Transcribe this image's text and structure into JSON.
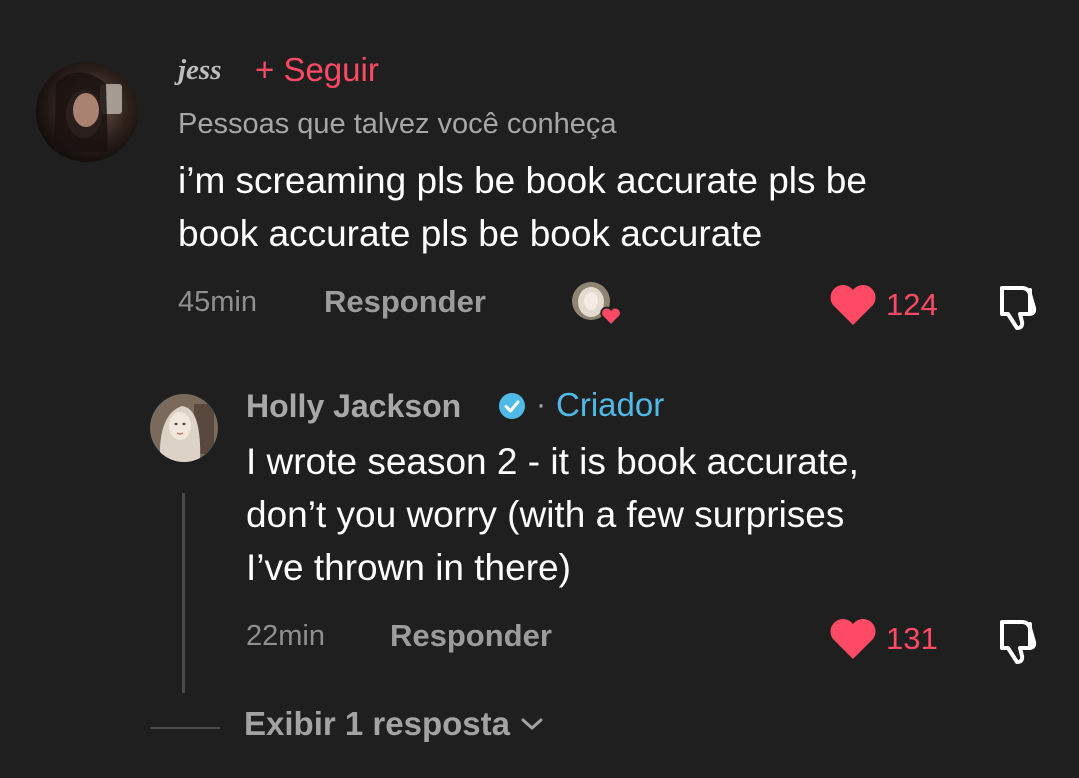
{
  "comments": [
    {
      "username": "jess",
      "follow_label": "+ Seguir",
      "subtext": "Pessoas que talvez você conheça",
      "text": "i’m screaming pls be book accurate pls be\nbook accurate pls be book accurate",
      "time": "45min",
      "reply_label": "Responder",
      "likes": "124"
    }
  ],
  "reply": {
    "author": "Holly Jackson",
    "separator": "·",
    "badge": "Criador",
    "text": "I wrote season 2 - it is book accurate,\ndon’t you worry (with a few surprises\nI’ve thrown in there)",
    "time": "22min",
    "reply_label": "Responder",
    "likes": "131"
  },
  "view_replies_label": "Exibir 1 resposta",
  "colors": {
    "background": "#1f1f1f",
    "like": "#fe4a64",
    "creator": "#4fb9e8",
    "verified": "#4fb9e8"
  },
  "icons": [
    "heart-icon",
    "thumbs-down-icon",
    "verified-badge-icon",
    "chevron-down-icon"
  ]
}
